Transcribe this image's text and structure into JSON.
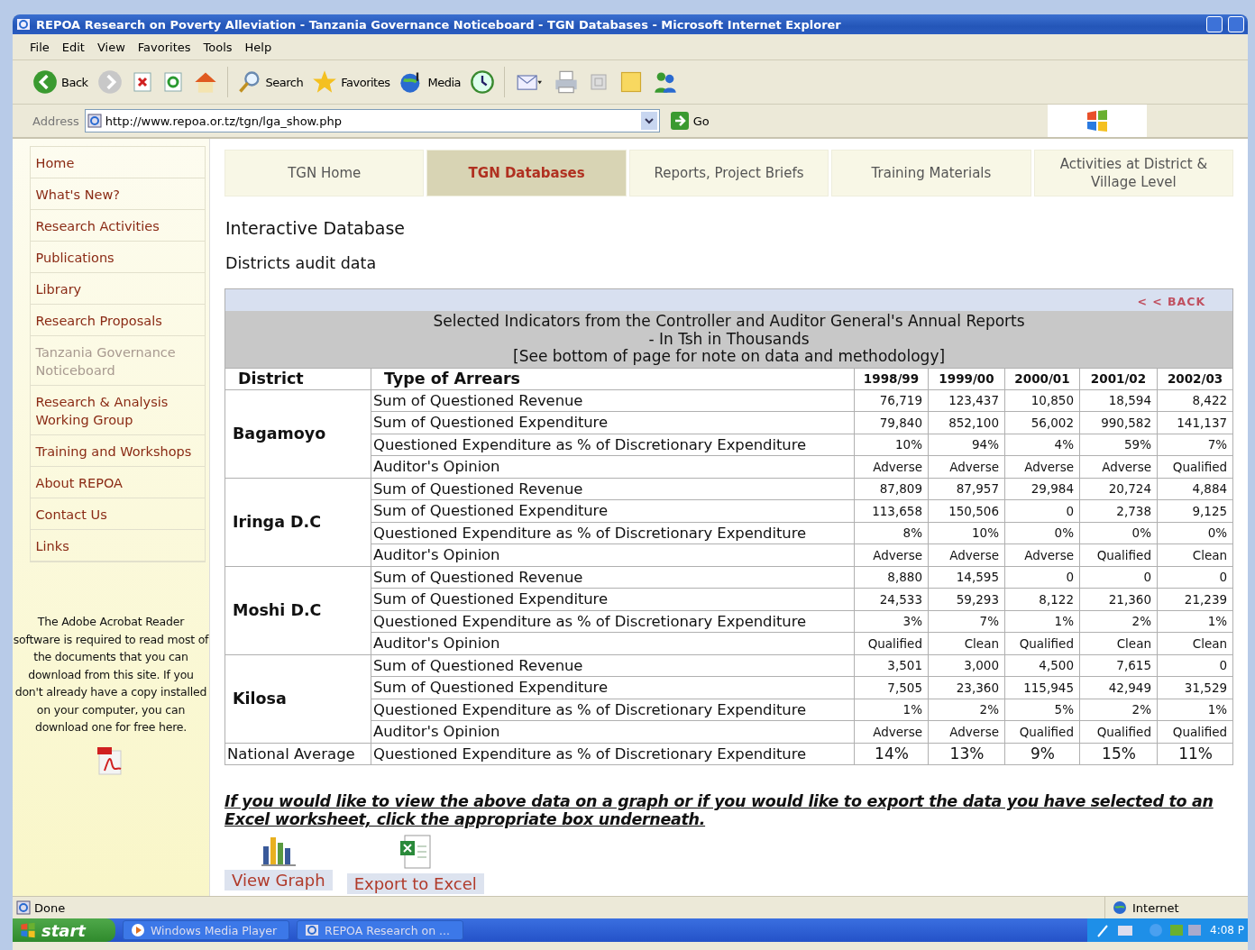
{
  "window": {
    "title": "REPOA Research on Poverty Alleviation - Tanzania Governance Noticeboard - TGN Databases - Microsoft Internet Explorer"
  },
  "menu": [
    "File",
    "Edit",
    "View",
    "Favorites",
    "Tools",
    "Help"
  ],
  "toolbar": [
    {
      "kind": "back",
      "label": "Back"
    },
    {
      "kind": "forward"
    },
    {
      "kind": "stop"
    },
    {
      "kind": "refresh"
    },
    {
      "kind": "home"
    },
    {
      "kind": "search",
      "label": "Search"
    },
    {
      "kind": "favorites",
      "label": "Favorites"
    },
    {
      "kind": "media",
      "label": "Media"
    },
    {
      "kind": "history"
    },
    {
      "kind": "mail"
    },
    {
      "kind": "print"
    },
    {
      "kind": "edit"
    },
    {
      "kind": "note"
    },
    {
      "kind": "messenger"
    }
  ],
  "address": {
    "label": "Address",
    "value": "http://www.repoa.or.tz/tgn/lga_show.php",
    "go": "Go"
  },
  "sidebar": {
    "items": [
      {
        "label": "Home",
        "selected": false
      },
      {
        "label": "What's New?",
        "selected": false
      },
      {
        "label": "Research Activities",
        "selected": false
      },
      {
        "label": "Publications",
        "selected": false
      },
      {
        "label": "Library",
        "selected": false
      },
      {
        "label": "Research Proposals",
        "selected": false
      },
      {
        "label": "Tanzania Governance Noticeboard",
        "selected": true
      },
      {
        "label": "Research & Analysis Working Group",
        "selected": false
      },
      {
        "label": "Training and Workshops",
        "selected": false
      },
      {
        "label": "About REPOA",
        "selected": false
      },
      {
        "label": "Contact Us",
        "selected": false
      },
      {
        "label": "Links",
        "selected": false
      }
    ],
    "note": "The Adobe Acrobat Reader software is required to read most of the documents that you can download from this site. If you don't already have a copy installed on your computer, you can download one for free here."
  },
  "tabs": [
    {
      "label": "TGN Home",
      "selected": false
    },
    {
      "label": "TGN Databases",
      "selected": true
    },
    {
      "label": "Reports, Project Briefs",
      "selected": false
    },
    {
      "label": "Training Materials",
      "selected": false
    },
    {
      "label": "Activities at District & Village Level",
      "selected": false
    }
  ],
  "heading": "Interactive Database",
  "subheading": "Districts audit data",
  "table": {
    "back": "< < BACK",
    "title": [
      "Selected Indicators from the Controller and Auditor General's Annual Reports",
      "- In Tsh in Thousands",
      "[See bottom of page for note on data and methodology]"
    ],
    "columns": [
      "District",
      "Type of Arrears",
      "1998/99",
      "1999/00",
      "2000/01",
      "2001/02",
      "2002/03"
    ],
    "groups": [
      {
        "district": "Bagamoyo",
        "rows": [
          {
            "type": "Sum of Questioned Revenue",
            "values": [
              "76,719",
              "123,437",
              "10,850",
              "18,594",
              "8,422"
            ]
          },
          {
            "type": "Sum of Questioned Expenditure",
            "values": [
              "79,840",
              "852,100",
              "56,002",
              "990,582",
              "141,137"
            ]
          },
          {
            "type": "Questioned Expenditure as % of Discretionary Expenditure",
            "values": [
              "10%",
              "94%",
              "4%",
              "59%",
              "7%"
            ]
          },
          {
            "type": "Auditor's Opinion",
            "values": [
              "Adverse",
              "Adverse",
              "Adverse",
              "Adverse",
              "Qualified"
            ]
          }
        ]
      },
      {
        "district": "Iringa D.C",
        "rows": [
          {
            "type": "Sum of Questioned Revenue",
            "values": [
              "87,809",
              "87,957",
              "29,984",
              "20,724",
              "4,884"
            ]
          },
          {
            "type": "Sum of Questioned Expenditure",
            "values": [
              "113,658",
              "150,506",
              "0",
              "2,738",
              "9,125"
            ]
          },
          {
            "type": "Questioned Expenditure as % of Discretionary Expenditure",
            "values": [
              "8%",
              "10%",
              "0%",
              "0%",
              "0%"
            ]
          },
          {
            "type": "Auditor's Opinion",
            "values": [
              "Adverse",
              "Adverse",
              "Adverse",
              "Qualified",
              "Clean"
            ]
          }
        ]
      },
      {
        "district": "Moshi D.C",
        "rows": [
          {
            "type": "Sum of Questioned Revenue",
            "values": [
              "8,880",
              "14,595",
              "0",
              "0",
              "0"
            ]
          },
          {
            "type": "Sum of Questioned Expenditure",
            "values": [
              "24,533",
              "59,293",
              "8,122",
              "21,360",
              "21,239"
            ]
          },
          {
            "type": "Questioned Expenditure as % of Discretionary Expenditure",
            "values": [
              "3%",
              "7%",
              "1%",
              "2%",
              "1%"
            ]
          },
          {
            "type": "Auditor's Opinion",
            "values": [
              "Qualified",
              "Clean",
              "Qualified",
              "Clean",
              "Clean"
            ]
          }
        ]
      },
      {
        "district": "Kilosa",
        "rows": [
          {
            "type": "Sum of Questioned Revenue",
            "values": [
              "3,501",
              "3,000",
              "4,500",
              "7,615",
              "0"
            ]
          },
          {
            "type": "Sum of Questioned Expenditure",
            "values": [
              "7,505",
              "23,360",
              "115,945",
              "42,949",
              "31,529"
            ]
          },
          {
            "type": "Questioned Expenditure as % of Discretionary Expenditure",
            "values": [
              "1%",
              "2%",
              "5%",
              "2%",
              "1%"
            ]
          },
          {
            "type": "Auditor's Opinion",
            "values": [
              "Adverse",
              "Adverse",
              "Qualified",
              "Qualified",
              "Qualified"
            ]
          }
        ]
      }
    ],
    "average": {
      "district": "National Average",
      "type": "Questioned Expenditure as % of Discretionary Expenditure",
      "values": [
        "14%",
        "13%",
        "9%",
        "15%",
        "11%"
      ]
    }
  },
  "export_note": "If you would like to view the above data on a graph or if you would like to export the data you have selected to an Excel worksheet, click the appropriate box underneath.",
  "actions": [
    {
      "kind": "graph",
      "label": "View Graph"
    },
    {
      "kind": "excel",
      "label": "Export to Excel"
    }
  ],
  "status_bar": {
    "text": "Done",
    "zone": "Internet"
  },
  "taskbar": {
    "start": "start",
    "tasks": [
      {
        "kind": "media",
        "label": "Windows Media Player"
      },
      {
        "kind": "ie",
        "label": "REPOA Research on ..."
      }
    ],
    "clock": "4:08 P"
  }
}
